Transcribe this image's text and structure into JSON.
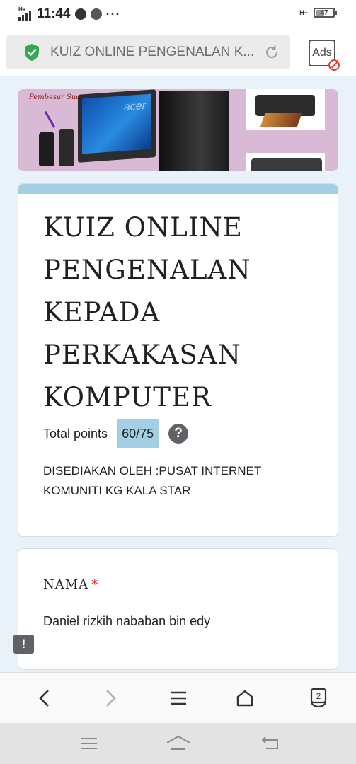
{
  "status_bar": {
    "network_type": "H+",
    "time": "11:44",
    "more": "···",
    "right_network": "H+",
    "battery_level": "47",
    "icons": [
      "signal-icon",
      "upload-icon",
      "chrome-icon",
      "network-icon",
      "battery-icon"
    ]
  },
  "browser": {
    "url_title": "KUIZ ONLINE PENGENALAN K...",
    "ads_label": "Ads",
    "icons": [
      "shield-check-icon",
      "reload-icon",
      "ads-block-icon"
    ]
  },
  "banner": {
    "speaker_label": "Pembesar Suara",
    "monitor_brand": "acer"
  },
  "form": {
    "title": "KUIZ ONLINE PENGENALAN KEPADA PERKAKASAN KOMPUTER",
    "points_label": "Total points",
    "points_value": "60/75",
    "help_symbol": "?",
    "description": "DISEDIAKAN OLEH :PUSAT INTERNET KOMUNITI KG KALA STAR",
    "accent_color": "#a3cfe4"
  },
  "question": {
    "title": "NAMA",
    "required_mark": "*",
    "answer": "Daniel rizkih nababan bin edy"
  },
  "report": {
    "symbol": "!"
  },
  "bottom_nav": {
    "tab_count": "2",
    "icons": [
      "back-icon",
      "forward-icon",
      "menu-icon",
      "home-icon",
      "tabs-icon"
    ]
  },
  "system_nav": {
    "icons": [
      "recents-icon",
      "home-icon",
      "back-icon"
    ]
  }
}
